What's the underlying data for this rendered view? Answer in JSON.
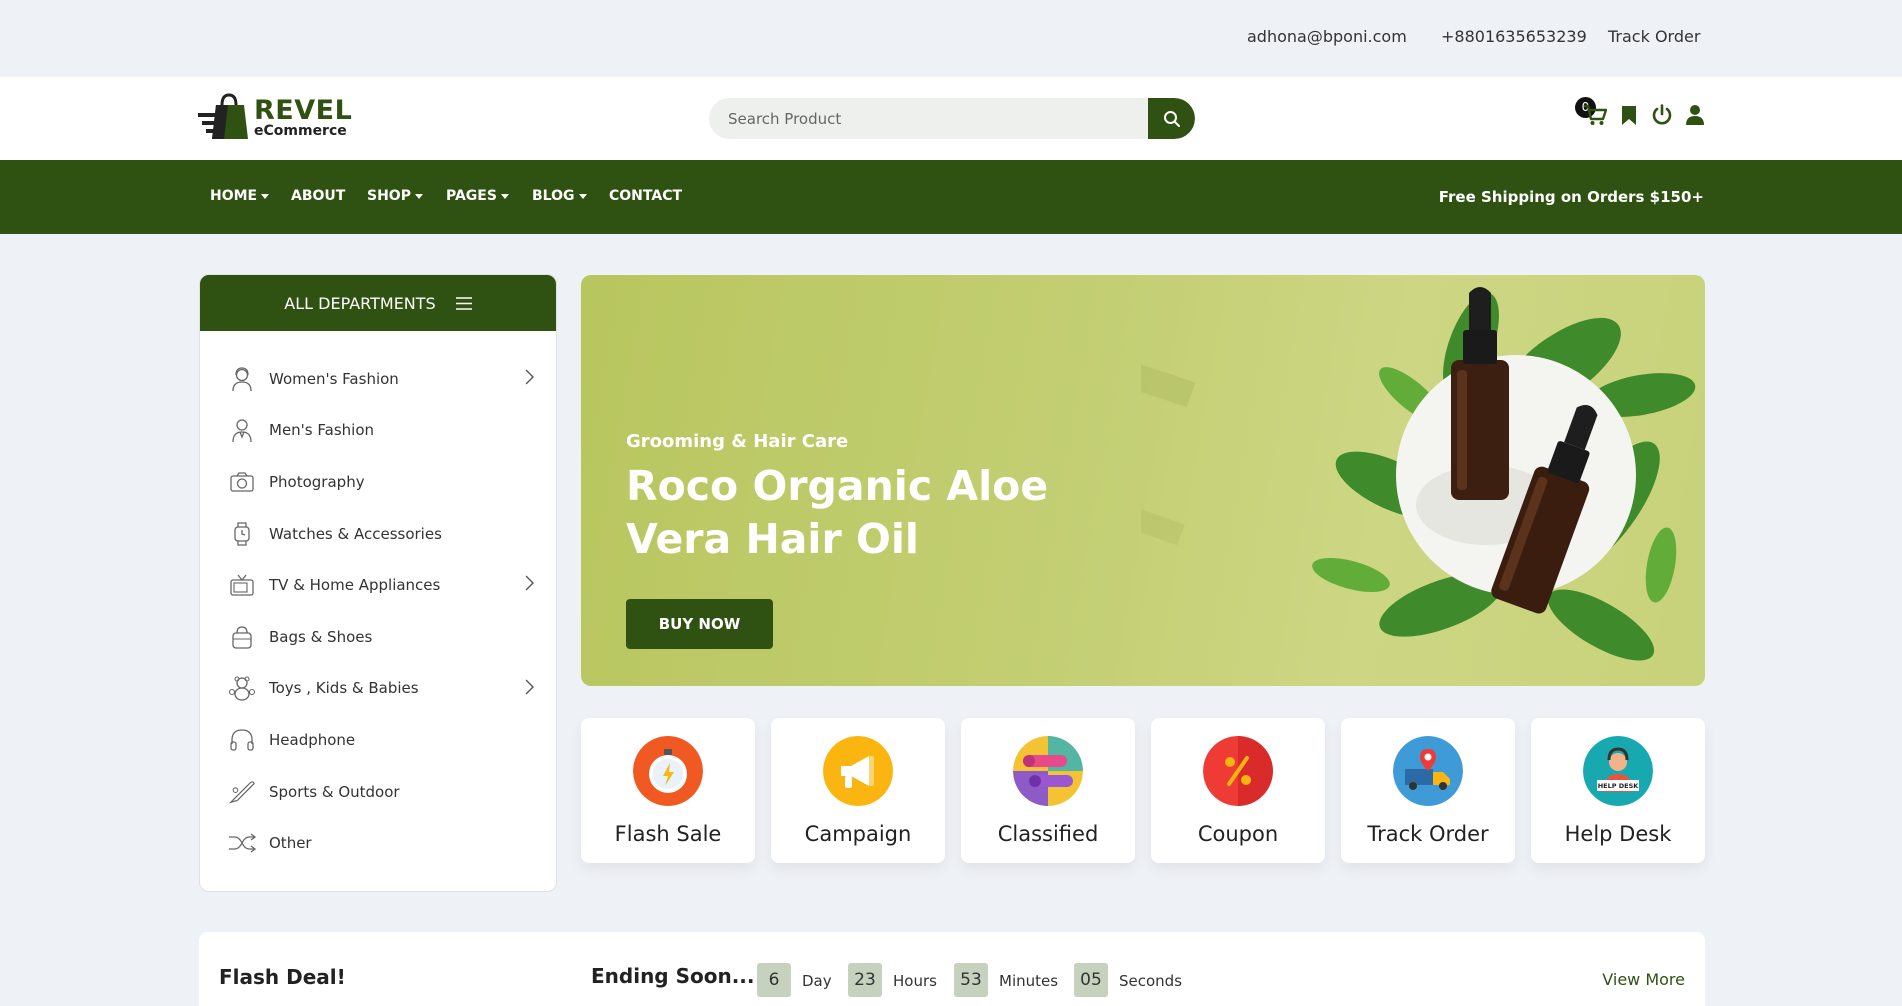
{
  "topbar": {
    "email": "adhona@bponi.com",
    "phone": "+8801635653239",
    "track_order": "Track Order"
  },
  "header": {
    "logo_brand": "REVEL",
    "logo_sub": "eCommerce",
    "search_placeholder": "Search Product",
    "cart_count": "0"
  },
  "nav": {
    "items": [
      "HOME",
      "ABOUT",
      "SHOP",
      "PAGES",
      "BLOG",
      "CONTACT"
    ],
    "promo": "Free Shipping on Orders $150+"
  },
  "departments": {
    "title": "ALL DEPARTMENTS",
    "items": [
      {
        "label": "Women's Fashion",
        "icon": "woman-icon"
      },
      {
        "label": "Men's Fashion",
        "icon": "man-icon"
      },
      {
        "label": "Photography",
        "icon": "camera-icon"
      },
      {
        "label": "Watches & Accessories",
        "icon": "watch-icon"
      },
      {
        "label": "TV & Home Appliances",
        "icon": "tv-icon"
      },
      {
        "label": "Bags & Shoes",
        "icon": "bag-icon"
      },
      {
        "label": "Toys , Kids & Babies",
        "icon": "teddy-bear-icon"
      },
      {
        "label": "Headphone",
        "icon": "headphone-icon"
      },
      {
        "label": "Sports & Outdoor",
        "icon": "bat-icon"
      },
      {
        "label": "Other",
        "icon": "shuffle-icon"
      }
    ]
  },
  "banner": {
    "subtitle": "Grooming & Hair Care",
    "title": "Roco Organic Aloe Vera Hair Oil",
    "button": "BUY NOW"
  },
  "features": [
    {
      "label": "Flash Sale",
      "icon": "stopwatch-icon",
      "color": "#f05a22"
    },
    {
      "label": "Campaign",
      "icon": "megaphone-icon",
      "color": "#fbb511"
    },
    {
      "label": "Classified",
      "icon": "list-icon",
      "color": "#f3c334"
    },
    {
      "label": "Coupon",
      "icon": "percent-icon",
      "color": "#ef3b36"
    },
    {
      "label": "Track Order",
      "icon": "delivery-truck-icon",
      "color": "#3f9ad8"
    },
    {
      "label": "Help Desk",
      "icon": "headset-icon",
      "color": "#18a9b0"
    }
  ],
  "flash_deal": {
    "title": "Flash Deal!",
    "ending": "Ending Soon...",
    "days": "6",
    "days_label": "Day",
    "hours": "23",
    "hours_label": "Hours",
    "minutes": "53",
    "minutes_label": "Minutes",
    "seconds": "05",
    "seconds_label": "Seconds",
    "view_more": "View More"
  },
  "colors": {
    "brand": "#2f5212",
    "page_bg": "#eef1f5"
  }
}
